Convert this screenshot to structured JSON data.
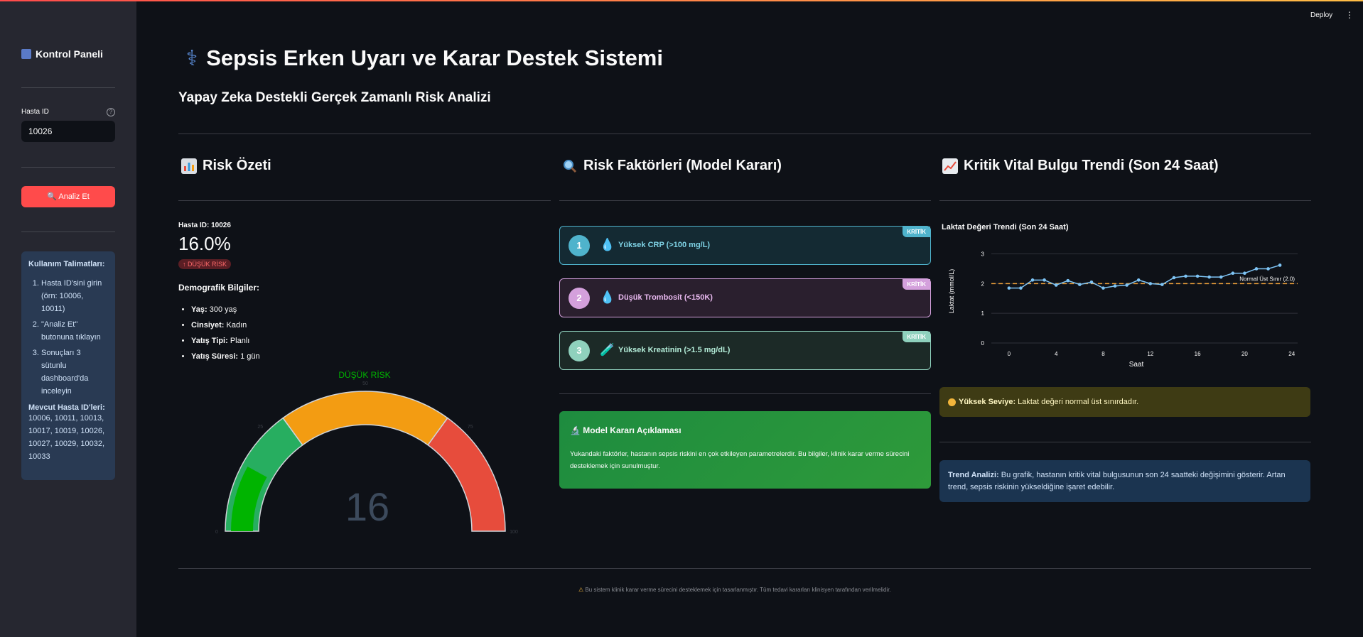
{
  "sidebar": {
    "title": "Kontrol Paneli",
    "patient_id_label": "Hasta ID",
    "patient_id_value": "10026",
    "analyze_button": "🔍 Analiz Et",
    "instructions": {
      "title": "Kullanım Talimatları:",
      "steps": [
        "Hasta ID'sini girin (örn: 10006, 10011)",
        "\"Analiz Et\" butonuna tıklayın",
        "Sonuçları 3 sütunlu dashboard'da inceleyin"
      ],
      "ids_title": "Mevcut Hasta ID'leri:",
      "ids": "10006, 10011, 10013, 10017, 10019, 10026, 10027, 10029, 10032, 10033"
    }
  },
  "header": {
    "deploy": "Deploy",
    "title": "Sepsis Erken Uyarı ve Karar Destek Sistemi",
    "subtitle": "Yapay Zeka Destekli Gerçek Zamanlı Risk Analizi"
  },
  "risk_summary": {
    "title": "Risk Özeti",
    "patient_id": "Hasta ID: 10026",
    "risk_value": "16.0%",
    "risk_badge": "↑ DÜŞÜK RİSK",
    "demo_title": "Demografik Bilgiler:",
    "demographics": [
      {
        "label": "Yaş:",
        "value": "300 yaş"
      },
      {
        "label": "Cinsiyet:",
        "value": "Kadın"
      },
      {
        "label": "Yatış Tipi:",
        "value": "Planlı"
      },
      {
        "label": "Yatış Süresi:",
        "value": "1 gün"
      }
    ],
    "gauge": {
      "title": "DÜŞÜK RİSK",
      "value": 16,
      "value_label": "16",
      "min": 0,
      "max": 100,
      "ticks": [
        "0",
        "25",
        "50",
        "75",
        "100"
      ],
      "bands": [
        {
          "from": 0,
          "to": 30,
          "color": "#27ae60"
        },
        {
          "from": 30,
          "to": 70,
          "color": "#f39c12"
        },
        {
          "from": 70,
          "to": 100,
          "color": "#e74c3c"
        }
      ],
      "bar_color": "#00b400"
    }
  },
  "risk_factors": {
    "title": "Risk Faktörleri (Model Kararı)",
    "items": [
      {
        "num": "1",
        "icon": "💧",
        "text": "Yüksek CRP (>100 mg/L)",
        "tag": "KRİTİK",
        "color": "#4fb3cc",
        "text_color": "#7fd3e6",
        "bg": "#142a33"
      },
      {
        "num": "2",
        "icon": "💧",
        "text": "Düşük Trombosit (<150K)",
        "tag": "KRİTİK",
        "color": "#d4a0dc",
        "text_color": "#e8b8ef",
        "bg": "#2a1f2e"
      },
      {
        "num": "3",
        "icon": "🧪",
        "text": "Yüksek Kreatinin (>1.5 mg/dL)",
        "tag": "KRİTİK",
        "color": "#8fd1bd",
        "text_color": "#b3ecd8",
        "bg": "#1c2a27"
      }
    ],
    "model_box_title": "🔬 Model Kararı Açıklaması",
    "model_box_text": "Yukandaki faktörler, hastanın sepsis riskini en çok etkileyen parametrelerdir. Bu bilgiler, klinik karar verme sürecini desteklemek için sunulmuştur."
  },
  "vital_trend": {
    "title": "Kritik Vital Bulgu Trendi (Son 24 Saat)",
    "warning_label": "Yüksek Seviye:",
    "warning_text": " Laktat değeri normal üst sınırdadır.",
    "analysis_label": "Trend Analizi:",
    "analysis_text": " Bu grafik, hastanın kritik vital bulgusunun son 24 saatteki değişimini gösterir. Artan trend, sepsis riskinin yükseldiğine işaret edebilir."
  },
  "chart_data": {
    "type": "line",
    "title": "Laktat Değeri Trendi (Son 24 Saat)",
    "xlabel": "Saat",
    "ylabel": "Laktat (mmol/L)",
    "xlim": [
      -1.5,
      24.5
    ],
    "ylim": [
      0,
      3.3
    ],
    "x_ticks": [
      0,
      4,
      8,
      12,
      16,
      20,
      24
    ],
    "y_ticks": [
      0,
      1,
      2,
      3
    ],
    "x": [
      0,
      1,
      2,
      3,
      4,
      5,
      6,
      7,
      8,
      9,
      10,
      11,
      12,
      13,
      14,
      15,
      16,
      17,
      18,
      19,
      20,
      21,
      22,
      23
    ],
    "series": [
      {
        "values": [
          1.85,
          1.85,
          2.12,
          2.12,
          1.95,
          2.1,
          1.97,
          2.05,
          1.85,
          1.92,
          1.95,
          2.12,
          2.0,
          1.97,
          2.2,
          2.25,
          2.25,
          2.22,
          2.22,
          2.35,
          2.35,
          2.5,
          2.5,
          2.62
        ],
        "color": "#7ec4f5"
      }
    ],
    "threshold": {
      "value": 2.0,
      "label": "Normal Üst Sınır (2.0)",
      "color": "#f2a33a"
    },
    "grid": true
  },
  "footer": {
    "text": "Bu sistem klinik karar verme sürecini desteklemek için tasarlanmıştır. Tüm tedavi kararları klinisyen tarafından verilmelidir."
  }
}
